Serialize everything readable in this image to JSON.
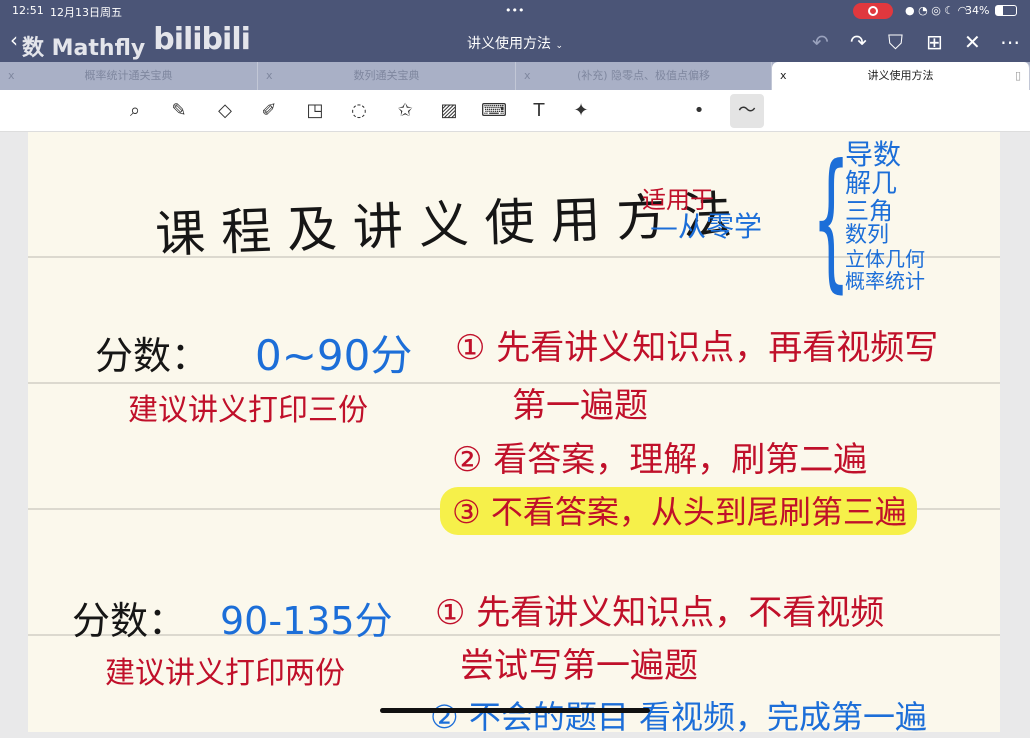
{
  "status": {
    "time": "12:51",
    "date": "12月13日周五",
    "battery": "34%",
    "dots": "•••"
  },
  "nav": {
    "title": "讲义使用方法",
    "back": "‹",
    "watermark": "数 Mathfly",
    "bilibili": "bilibili"
  },
  "tabs": [
    {
      "label": "概率统计通关宝典",
      "close": "x"
    },
    {
      "label": "数列通关宝典",
      "close": "x"
    },
    {
      "label": "(补充) 隐零点、极值点偏移",
      "close": "x"
    },
    {
      "label": "讲义使用方法",
      "close": "x"
    }
  ],
  "note": {
    "title": "课 程 及 讲 义 使 用 方 法",
    "applies": "适用于",
    "from_zero": "—从零学",
    "topics": [
      "导数",
      "解几",
      "三角",
      "数列",
      "立体几何",
      "概率统计"
    ],
    "s1_score_label": "分数：",
    "s1_score": "0~90分",
    "s1_print": "建议讲义打印三份",
    "s1_step1": "① 先看讲义知识点，再看视频写",
    "s1_step1b": "第一遍题",
    "s1_step2": "② 看答案，理解，刷第二遍",
    "s1_step3": "③ 不看答案，从头到尾刷第三遍",
    "s2_score_label": "分数：",
    "s2_score": "90-135分",
    "s2_print": "建议讲义打印两份",
    "s2_step1": "① 先看讲义知识点，不看视频",
    "s2_step1b": "尝试写第一遍题",
    "s2_step2": "② 不会的题目 看视频，完成第一遍"
  },
  "colors": {
    "ink": "#161616",
    "red": "#c0102a",
    "blue": "#1c6ed8",
    "highlight": "#f6f04a"
  }
}
